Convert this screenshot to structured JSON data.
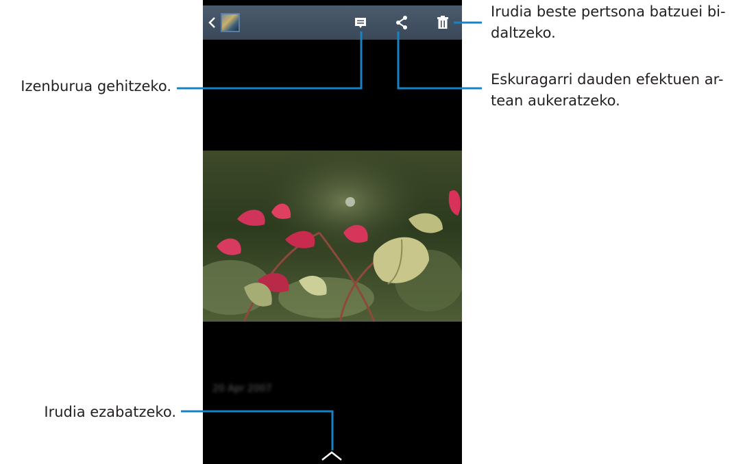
{
  "callouts": {
    "delete": "Irudia beste pertsona batzuei bi-daltzeko.",
    "share": "Eskuragarri dauden efektuen ar-tean aukeratzeko.",
    "caption": "Izenburua gehitzeko.",
    "details": "Irudia ezabatzeko."
  },
  "viewer": {
    "date_text": "20 Apr 2007",
    "icons": {
      "back": "chevron-left-icon",
      "thumbnail": "album-thumbnail",
      "caption": "caption-icon",
      "share": "share-icon",
      "delete": "trash-icon",
      "details": "chevron-up-icon"
    }
  },
  "colors": {
    "action_bar": "#43515f",
    "callout_line": "#1a82c4",
    "screen_bg": "#000000",
    "text": "#231f20"
  }
}
